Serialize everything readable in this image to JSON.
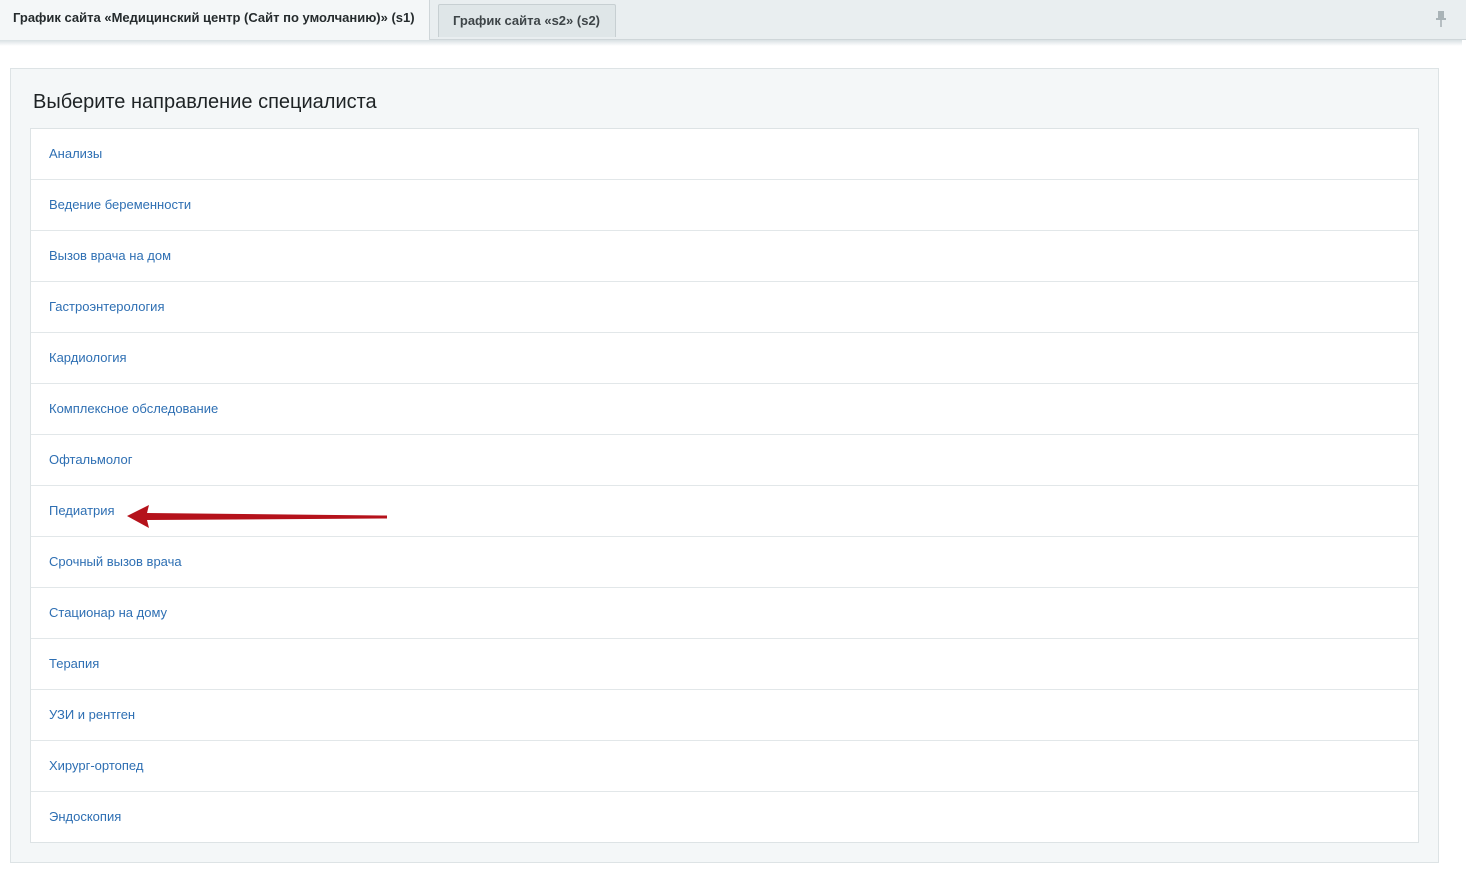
{
  "tabs": [
    {
      "label": "График сайта «Медицинский центр (Сайт по умолчанию)» (s1)",
      "active": true
    },
    {
      "label": "График сайта «s2» (s2)",
      "active": false
    }
  ],
  "pin_icon": "pin-icon",
  "panel": {
    "title": "Выберите направление специалиста",
    "items": [
      {
        "label": "Анализы"
      },
      {
        "label": "Ведение беременности"
      },
      {
        "label": "Вызов врача на дом"
      },
      {
        "label": "Гастроэнтерология"
      },
      {
        "label": "Кардиология"
      },
      {
        "label": "Комплексное обследование"
      },
      {
        "label": "Офтальмолог"
      },
      {
        "label": "Педиатрия"
      },
      {
        "label": "Срочный вызов врача"
      },
      {
        "label": "Стационар на дому"
      },
      {
        "label": "Терапия"
      },
      {
        "label": "УЗИ и рентген"
      },
      {
        "label": "Хирург-ортопед"
      },
      {
        "label": "Эндоскопия"
      }
    ]
  },
  "annotation": {
    "icon": "arrow-left-icon",
    "points_to": "Педиатрия",
    "color": "#b5121b"
  },
  "colors": {
    "link": "#2e6fb3",
    "panel_bg": "#f4f7f8",
    "tabbar_bg": "#e9eef0"
  }
}
